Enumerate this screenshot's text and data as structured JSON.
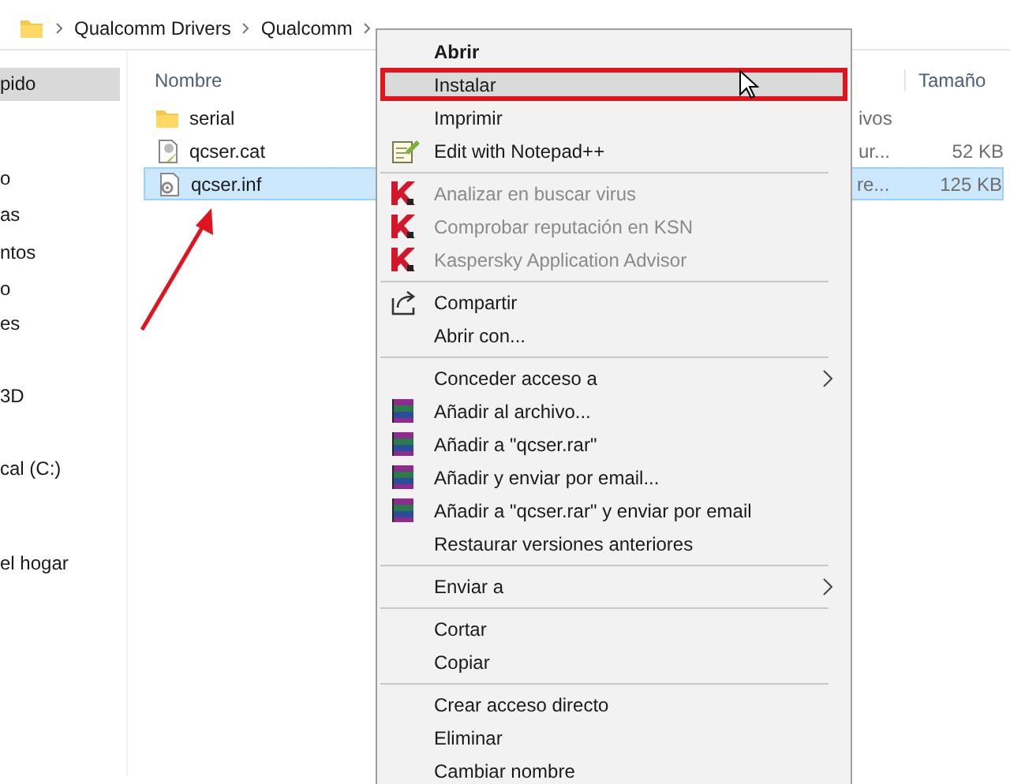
{
  "breadcrumb": [
    {
      "label": "Qualcomm Drivers"
    },
    {
      "label": "Qualcomm"
    }
  ],
  "sidebar": {
    "items": [
      {
        "label": "pido",
        "selected": true
      },
      {
        "label": "o",
        "selected": false
      },
      {
        "label": "as",
        "selected": false
      },
      {
        "label": "ntos",
        "selected": false
      },
      {
        "label": "o",
        "selected": false
      },
      {
        "label": "es",
        "selected": false
      },
      {
        "label": "3D",
        "selected": false
      },
      {
        "label": "cal (C:)",
        "selected": false
      },
      {
        "label": "el hogar",
        "selected": false
      }
    ]
  },
  "file_list": {
    "columns": [
      "Nombre",
      "Tamaño"
    ],
    "rows": [
      {
        "name": "serial",
        "kind": "folder",
        "type": "ivos",
        "selected": false
      },
      {
        "name": "qcser.cat",
        "kind": "catalog",
        "type": "ur...",
        "size": "52 KB",
        "selected": false
      },
      {
        "name": "qcser.inf",
        "kind": "setup",
        "type": "re...",
        "size": "125 KB",
        "selected": true
      }
    ]
  },
  "context_menu": {
    "items": [
      {
        "kind": "item",
        "label": "Abrir",
        "default": true,
        "disabled": false,
        "highlighted": false,
        "submenu": false
      },
      {
        "kind": "item",
        "label": "Instalar",
        "default": false,
        "disabled": false,
        "highlighted": true,
        "submenu": false
      },
      {
        "kind": "item",
        "label": "Imprimir",
        "default": false,
        "disabled": false,
        "highlighted": false,
        "submenu": false
      },
      {
        "kind": "notepad",
        "label": "Edit with Notepad++",
        "default": false,
        "disabled": false,
        "highlighted": false,
        "submenu": false
      },
      {
        "kind": "separator"
      },
      {
        "kind": "scanner",
        "label": "Analizar en buscar virus",
        "default": false,
        "disabled": true,
        "highlighted": false,
        "submenu": false
      },
      {
        "kind": "scanner",
        "label": "Comprobar reputación en KSN",
        "default": false,
        "disabled": true,
        "highlighted": false,
        "submenu": false
      },
      {
        "kind": "scanner",
        "label": "Kaspersky Application Advisor",
        "default": false,
        "disabled": true,
        "highlighted": false,
        "submenu": false
      },
      {
        "kind": "separator"
      },
      {
        "kind": "share",
        "label": "Compartir",
        "default": false,
        "disabled": false,
        "highlighted": false,
        "submenu": false
      },
      {
        "kind": "item",
        "label": "Abrir con...",
        "default": false,
        "disabled": false,
        "highlighted": false,
        "submenu": false
      },
      {
        "kind": "separator"
      },
      {
        "kind": "item",
        "label": "Conceder acceso a",
        "default": false,
        "disabled": false,
        "highlighted": false,
        "submenu": true
      },
      {
        "kind": "archiver",
        "label": "Añadir al archivo...",
        "default": false,
        "disabled": false,
        "highlighted": false,
        "submenu": false
      },
      {
        "kind": "archiver",
        "label": "Añadir a \"qcser.rar\"",
        "default": false,
        "disabled": false,
        "highlighted": false,
        "submenu": false
      },
      {
        "kind": "archiver",
        "label": "Añadir y enviar por email...",
        "default": false,
        "disabled": false,
        "highlighted": false,
        "submenu": false
      },
      {
        "kind": "archiver",
        "label": "Añadir a \"qcser.rar\" y enviar por email",
        "default": false,
        "disabled": false,
        "highlighted": false,
        "submenu": false
      },
      {
        "kind": "item",
        "label": "Restaurar versiones anteriores",
        "default": false,
        "disabled": false,
        "highlighted": false,
        "submenu": false
      },
      {
        "kind": "separator"
      },
      {
        "kind": "item",
        "label": "Enviar a",
        "default": false,
        "disabled": false,
        "highlighted": false,
        "submenu": true
      },
      {
        "kind": "separator"
      },
      {
        "kind": "item",
        "label": "Cortar",
        "default": false,
        "disabled": false,
        "highlighted": false,
        "submenu": false
      },
      {
        "kind": "item",
        "label": "Copiar",
        "default": false,
        "disabled": false,
        "highlighted": false,
        "submenu": false
      },
      {
        "kind": "separator"
      },
      {
        "kind": "item",
        "label": "Crear acceso directo",
        "default": false,
        "disabled": false,
        "highlighted": false,
        "submenu": false
      },
      {
        "kind": "item",
        "label": "Eliminar",
        "default": false,
        "disabled": false,
        "highlighted": false,
        "submenu": false
      },
      {
        "kind": "item",
        "label": "Cambiar nombre",
        "default": false,
        "disabled": false,
        "highlighted": false,
        "submenu": false
      }
    ]
  }
}
